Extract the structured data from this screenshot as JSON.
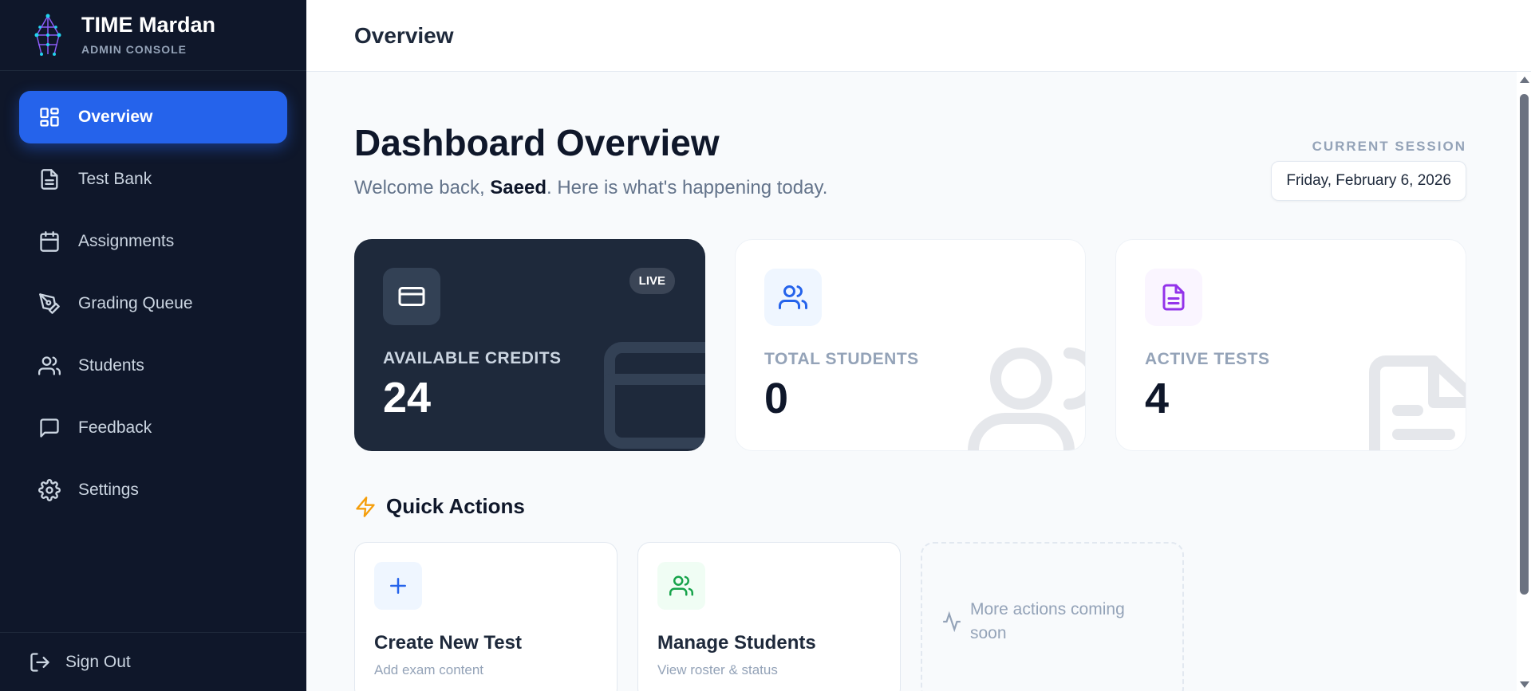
{
  "brand": {
    "title": "TIME Mardan",
    "subtitle": "ADMIN CONSOLE"
  },
  "sidebar": {
    "items": [
      {
        "label": "Overview",
        "icon": "layout-grid-icon",
        "active": true
      },
      {
        "label": "Test Bank",
        "icon": "file-text-icon",
        "active": false
      },
      {
        "label": "Assignments",
        "icon": "calendar-icon",
        "active": false
      },
      {
        "label": "Grading Queue",
        "icon": "pen-tool-icon",
        "active": false
      },
      {
        "label": "Students",
        "icon": "users-icon",
        "active": false
      },
      {
        "label": "Feedback",
        "icon": "message-square-icon",
        "active": false
      },
      {
        "label": "Settings",
        "icon": "gear-icon",
        "active": false
      }
    ],
    "signout": "Sign Out"
  },
  "header": {
    "title": "Overview"
  },
  "main": {
    "title": "Dashboard Overview",
    "welcome_prefix": "Welcome back, ",
    "welcome_name": "Saeed",
    "welcome_suffix": ". Here is what's happening today.",
    "session_label": "CURRENT SESSION",
    "session_date": "Friday, February 6, 2026"
  },
  "stats": [
    {
      "label": "AVAILABLE CREDITS",
      "value": "24",
      "badge": "LIVE",
      "icon": "credit-card-icon",
      "accent": "#1e293b"
    },
    {
      "label": "TOTAL STUDENTS",
      "value": "0",
      "icon": "users-icon",
      "accent": "#2563eb"
    },
    {
      "label": "ACTIVE TESTS",
      "value": "4",
      "icon": "file-text-icon",
      "accent": "#9333ea"
    }
  ],
  "quick_actions": {
    "title": "Quick Actions",
    "items": [
      {
        "title": "Create New Test",
        "subtitle": "Add exam content",
        "icon": "plus-icon",
        "accent": "#2563eb"
      },
      {
        "title": "Manage Students",
        "subtitle": "View roster & status",
        "icon": "users-icon",
        "accent": "#16a34a"
      }
    ],
    "placeholder": "More actions coming soon"
  },
  "colors": {
    "sidebar_bg": "#0f172a",
    "primary": "#2563eb",
    "bg": "#f8fafc"
  }
}
